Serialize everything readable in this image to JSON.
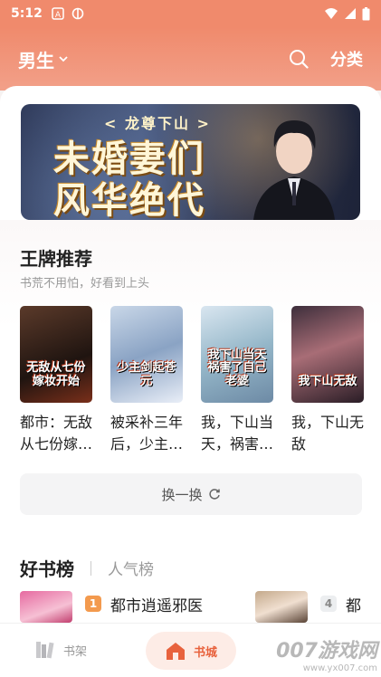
{
  "status_bar": {
    "time": "5:12"
  },
  "header": {
    "gender_label": "男生",
    "category_label": "分类"
  },
  "banner": {
    "subtitle": "< 龙尊下山 >",
    "title_line1": "未婚妻们",
    "title_line2": "风华绝代"
  },
  "section": {
    "title": "王牌推荐",
    "subtitle": "书荒不用怕，好看到上头"
  },
  "books": [
    {
      "title": "都市：无敌从七份嫁…",
      "cover_text": "无敌从七份嫁妆开始"
    },
    {
      "title": "被采补三年后，少主…",
      "cover_text": "少主剑起苍元"
    },
    {
      "title": "我，下山当天，祸害…",
      "cover_text": "我下山当天祸害了自己老婆"
    },
    {
      "title": "我，下山无敌",
      "cover_text": "我下山无敌"
    }
  ],
  "swap_label": "换一换",
  "ranking_tabs": {
    "active": "好书榜",
    "inactive": "人气榜"
  },
  "ranking": [
    {
      "rank": "1",
      "title": "都市逍遥邪医"
    },
    {
      "rank": "4",
      "title": "都"
    }
  ],
  "bottom_nav": {
    "shelf_label": "书架",
    "store_label": "书城"
  },
  "watermark": {
    "main": "007游戏网",
    "url": "www.yx007.com"
  },
  "colors": {
    "accent": "#f08a6c",
    "active_nav": "#e8623d",
    "rank1": "#f39a4e"
  },
  "icons": [
    "search-icon",
    "chevron-down-icon",
    "refresh-icon",
    "bookshelf-icon",
    "home-icon",
    "wifi-icon",
    "signal-icon",
    "battery-icon"
  ]
}
